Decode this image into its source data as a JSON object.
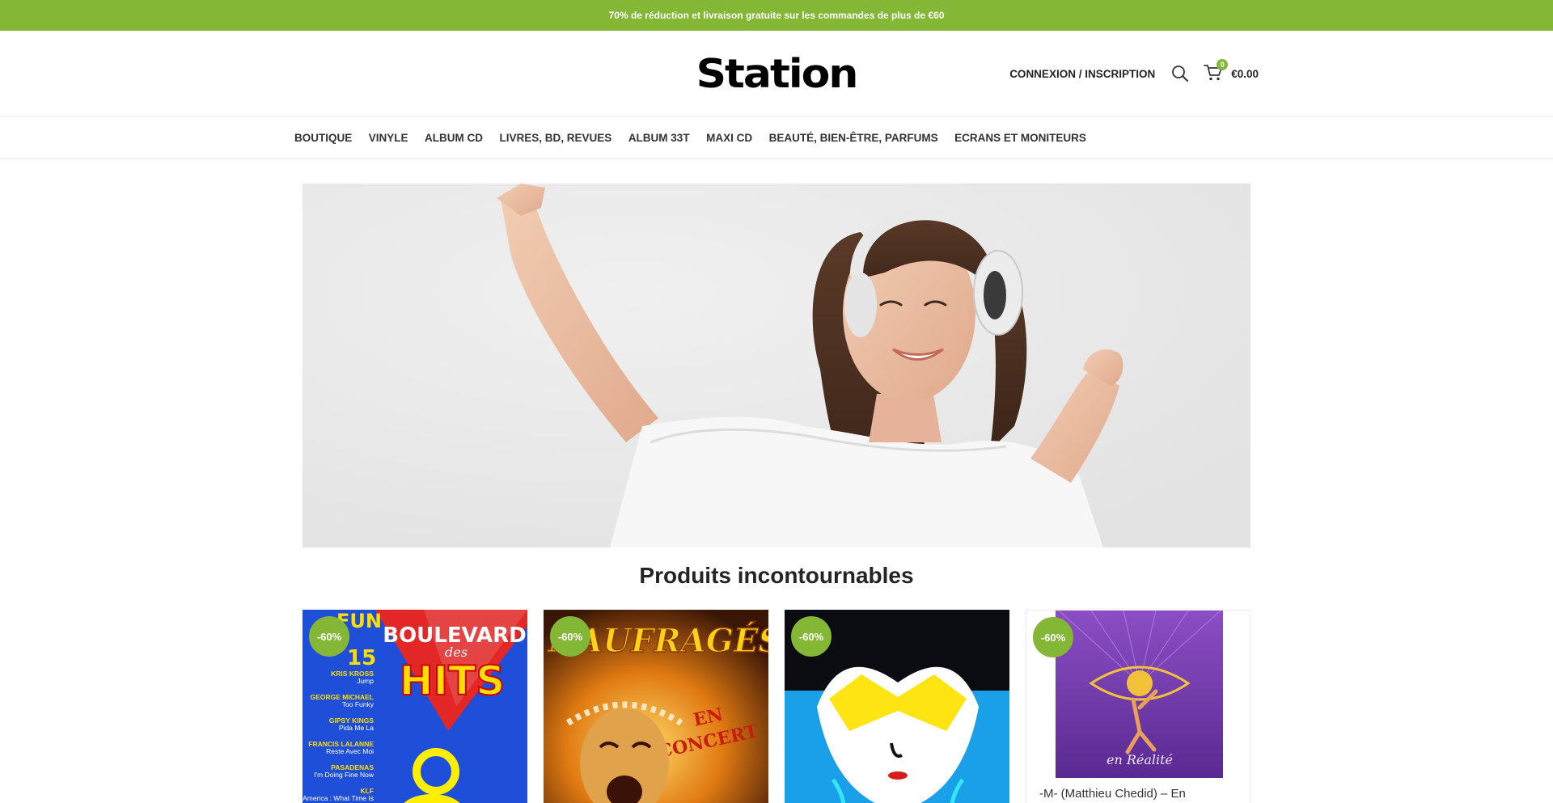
{
  "promo": {
    "text": "70% de réduction et livraison gratuite sur les commandes de plus de €60",
    "bg": "#83b735"
  },
  "header": {
    "logo": "Station",
    "login_label": "CONNEXION / INSCRIPTION",
    "search_icon": "search-icon",
    "cart": {
      "count": "0",
      "total": "€0.00",
      "icon": "cart-icon"
    }
  },
  "nav": {
    "items": [
      {
        "label": "BOUTIQUE"
      },
      {
        "label": "VINYLE"
      },
      {
        "label": "ALBUM CD"
      },
      {
        "label": "LIVRES, BD, REVUES"
      },
      {
        "label": "ALBUM 33T"
      },
      {
        "label": "MAXI CD"
      },
      {
        "label": "BEAUTÉ, BIEN-ÊTRE, PARFUMS"
      },
      {
        "label": "ECRANS ET MONITEURS"
      }
    ]
  },
  "hero": {
    "image": "woman-with-headphones-dancing"
  },
  "section": {
    "title": "Produits incontournables"
  },
  "products": [
    {
      "badge": "-60%",
      "title": "",
      "cover": {
        "brand": "FUN",
        "line1": "BOULEVARD",
        "line2": "des",
        "line3": "HITS",
        "volume": "15",
        "tracks": [
          {
            "artist": "KRIS KROSS",
            "song": "Jump"
          },
          {
            "artist": "GEORGE MICHAEL",
            "song": "Too Funky"
          },
          {
            "artist": "GIPSY KINGS",
            "song": "Pida Me La"
          },
          {
            "artist": "FRANCIS LALANNE",
            "song": "Reste Avec Moi"
          },
          {
            "artist": "PASADENAS",
            "song": "I'm Doing Fine Now"
          },
          {
            "artist": "KLF",
            "song": "America : What Time Is"
          }
        ]
      }
    },
    {
      "badge": "-60%",
      "title": "",
      "cover": {
        "line1": "NAUFRAGÉS",
        "line2": "EN",
        "line3": "CONCERT"
      }
    },
    {
      "badge": "-60%",
      "title": "",
      "cover": {}
    },
    {
      "badge": "-60%",
      "title": "-M- (Matthieu Chedid) – En",
      "cover": {
        "script": "en Réalité"
      }
    }
  ],
  "colors": {
    "accent": "#83b735",
    "text": "#242424"
  }
}
